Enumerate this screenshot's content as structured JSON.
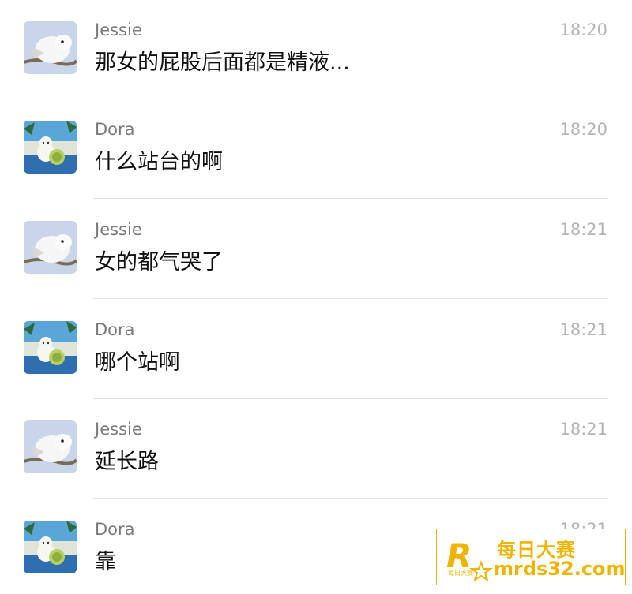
{
  "conversations": [
    {
      "sender": "Jessie",
      "avatar": "bird-avatar",
      "time": "18:20",
      "message": "那女的屁股后面都是精液..."
    },
    {
      "sender": "Dora",
      "avatar": "cat-avatar",
      "time": "18:20",
      "message": "什么站台的啊"
    },
    {
      "sender": "Jessie",
      "avatar": "bird-avatar",
      "time": "18:21",
      "message": "女的都气哭了"
    },
    {
      "sender": "Dora",
      "avatar": "cat-avatar",
      "time": "18:21",
      "message": "哪个站啊"
    },
    {
      "sender": "Jessie",
      "avatar": "bird-avatar",
      "time": "18:21",
      "message": "延长路"
    },
    {
      "sender": "Dora",
      "avatar": "cat-avatar",
      "time": "18:21",
      "message": "靠"
    }
  ],
  "watermark": {
    "logo_letter": "R",
    "logo_small_text": "每日大赛",
    "title": "每日大赛",
    "url": "mrds32.com",
    "color": "#f0b400"
  }
}
